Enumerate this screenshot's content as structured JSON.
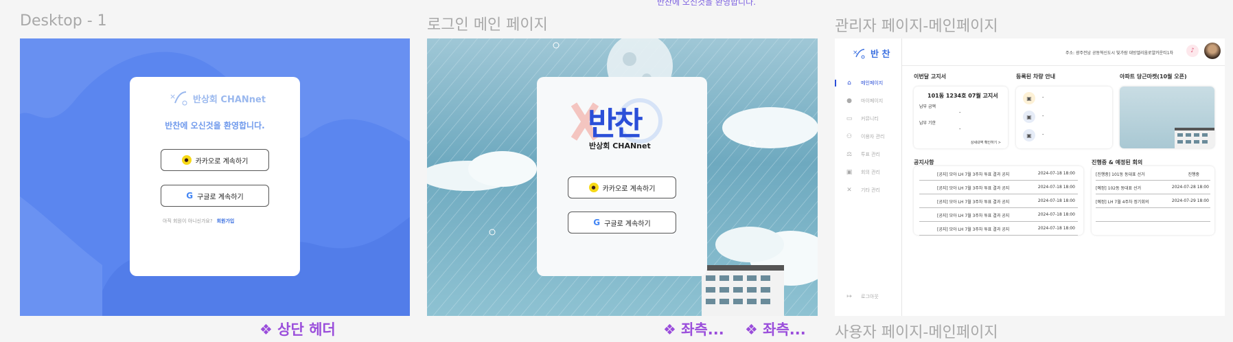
{
  "top_partial": "반찬에 오신것을 환영합니다.",
  "frames": {
    "desktop": {
      "title": "Desktop - 1",
      "logo_text": "반상회 CHANnet",
      "welcome": "반찬에 오신것을 환영합니다.",
      "kakao_label": "카카오로 계속하기",
      "google_label": "구글로 계속하기",
      "signup_prompt": "아직 회원이 아니신가요?",
      "signup_link": "회원가입"
    },
    "login": {
      "title": "로그인 메인 페이지",
      "logo_big": "반찬",
      "logo_sub": "반상회 CHANnet",
      "kakao_label": "카카오로 계속하기",
      "google_label": "구글로 계속하기"
    },
    "admin": {
      "title": "관리자 페이지-메인페이지",
      "brand": "반 찬",
      "address": "주소: 광주전남 공동혁신도시 빛가람 대방엘리움로얄카운티1차",
      "sidebar": [
        {
          "label": "메인페이지",
          "icon": "home-icon",
          "glyph": "⌂",
          "active": true
        },
        {
          "label": "마이페이지",
          "icon": "user-icon",
          "glyph": "●",
          "active": false
        },
        {
          "label": "커뮤니티",
          "icon": "chat-icon",
          "glyph": "▭",
          "active": false
        },
        {
          "label": "이용자 관리",
          "icon": "users-icon",
          "glyph": "⚇",
          "active": false
        },
        {
          "label": "투표 관리",
          "icon": "vote-icon",
          "glyph": "⚖",
          "active": false
        },
        {
          "label": "회의 관리",
          "icon": "meeting-icon",
          "glyph": "▣",
          "active": false
        },
        {
          "label": "기타 관리",
          "icon": "tools-icon",
          "glyph": "✕",
          "active": false
        }
      ],
      "logout": "로그아웃",
      "bill": {
        "section": "이번달 고지서",
        "heading": "101동 1234호 07월 고지서",
        "amount_label": "납부 금액",
        "amount_value": "-",
        "due_label": "납부 기한",
        "due_value": "-",
        "detail_link": "상세내역 확인하기 >"
      },
      "cars": {
        "section": "등록된 차량 안내",
        "items": [
          "-",
          "-",
          "-"
        ]
      },
      "market": {
        "section": "아파트 당근마켓(10월 오픈)"
      },
      "notices": {
        "section": "공지사항",
        "rows": [
          {
            "title": "[공지] 모아 LH 7월 3주차 투표 결과 공지",
            "date": "2024-07-18 18:00"
          },
          {
            "title": "[공지] 모아 LH 7월 3주차 투표 결과 공지",
            "date": "2024-07-18 18:00"
          },
          {
            "title": "[공지] 모아 LH 7월 3주차 투표 결과 공지",
            "date": "2024-07-18 18:00"
          },
          {
            "title": "[공지] 모아 LH 7월 3주차 투표 결과 공지",
            "date": "2024-07-18 18:00"
          },
          {
            "title": "[공지] 모아 LH 7월 3주차 투표 결과 공지",
            "date": "2024-07-18 18:00"
          }
        ]
      },
      "meetings": {
        "section": "진행중 & 예정된 회의",
        "rows": [
          {
            "title": "[진행중] 101동 동대표 선거",
            "date": "진행중"
          },
          {
            "title": "[예정] 102동 동대표 선거",
            "date": "2024-07-28 18:00"
          },
          {
            "title": "[예정] LH 7월 4주차 정기회의",
            "date": "2024-07-29 18:00"
          },
          {
            "title": "",
            "date": ""
          }
        ]
      }
    }
  },
  "bottom_labels": {
    "header": "❖ 상단 헤더",
    "left1": "❖ 좌측...",
    "left2": "❖ 좌측...",
    "user_page": "사용자 페이지-메인페이지"
  },
  "colors": {
    "desktop_bg": "#5b86ef",
    "accent": "#3a6fe0",
    "purple": "#9a4ddb",
    "kakao": "#f7d917"
  }
}
